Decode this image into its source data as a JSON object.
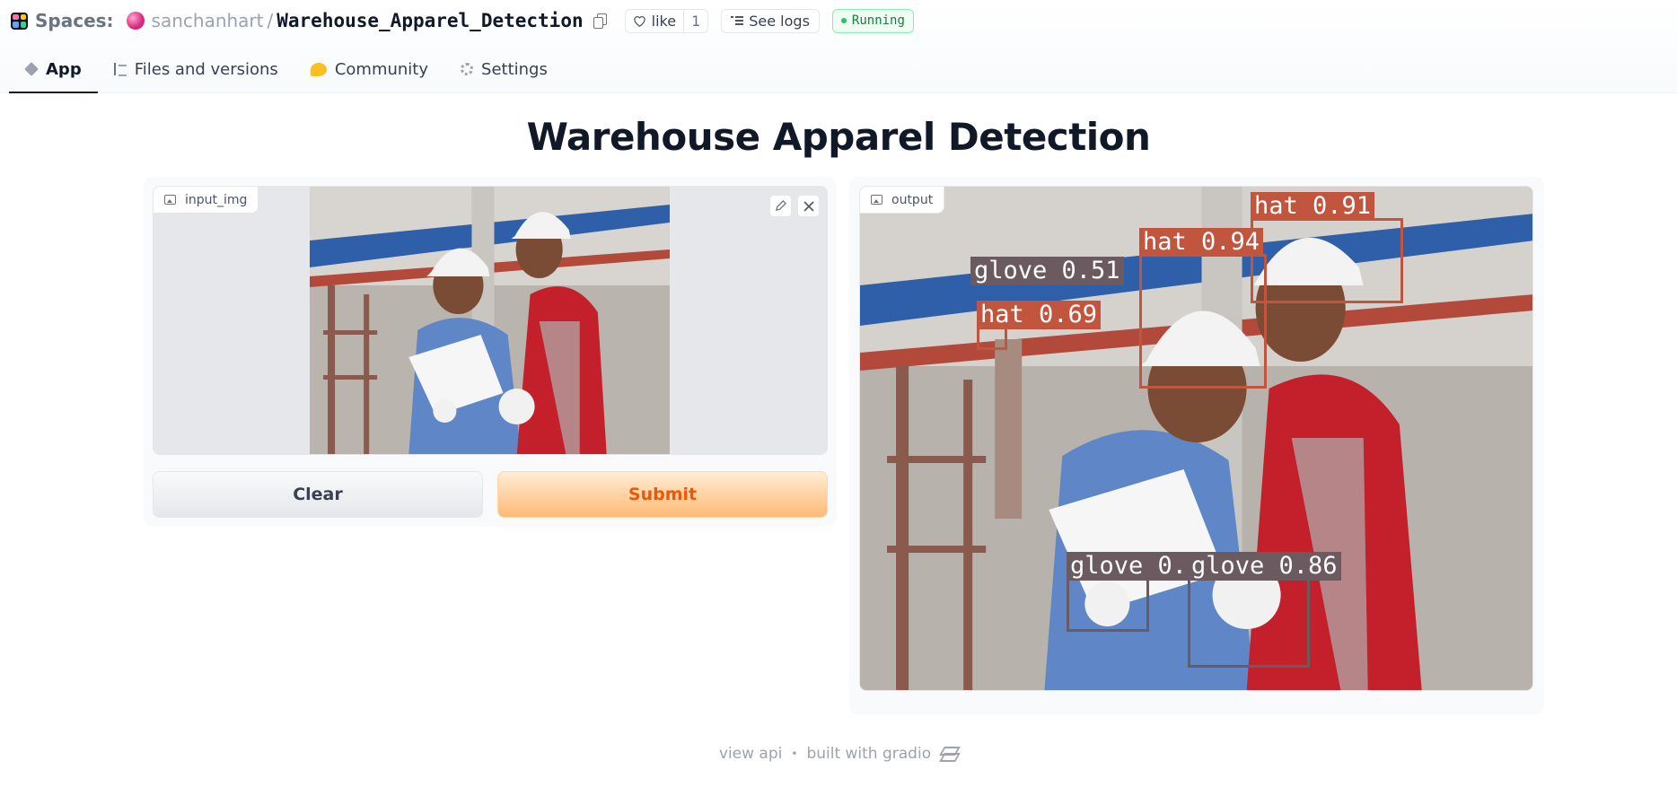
{
  "header": {
    "spaces_label": "Spaces:",
    "owner": "sanchanhart",
    "separator": "/",
    "repo_name": "Warehouse_Apparel_Detection",
    "like_label": "like",
    "like_count": "1",
    "logs_label": "See logs",
    "status": "Running",
    "status_color": "#15803d"
  },
  "tabs": [
    {
      "label": "App",
      "icon": "cube-icon",
      "active": true
    },
    {
      "label": "Files and versions",
      "icon": "files-icon",
      "active": false
    },
    {
      "label": "Community",
      "icon": "community-icon",
      "active": false
    },
    {
      "label": "Settings",
      "icon": "gear-icon",
      "active": false
    }
  ],
  "app": {
    "title": "Warehouse Apparel Detection",
    "input": {
      "label": "input_img"
    },
    "output": {
      "label": "output"
    },
    "buttons": {
      "clear": "Clear",
      "submit": "Submit"
    },
    "detections": [
      {
        "label": "hat 0.91",
        "class": "hat"
      },
      {
        "label": "hat 0.94",
        "class": "hat"
      },
      {
        "label": "glove 0.51",
        "class": "glove"
      },
      {
        "label": "hat 0.69",
        "class": "hat"
      },
      {
        "label": "glove 0.8",
        "class": "glove"
      },
      {
        "label": "glove 0.86",
        "class": "glove"
      }
    ]
  },
  "footer": {
    "view_api": "view api",
    "dot": "•",
    "built_with": "built with gradio"
  },
  "colors": {
    "accent": "#ea580c",
    "hat_box": "#c2553d",
    "glove_box": "#6b5a5f"
  }
}
